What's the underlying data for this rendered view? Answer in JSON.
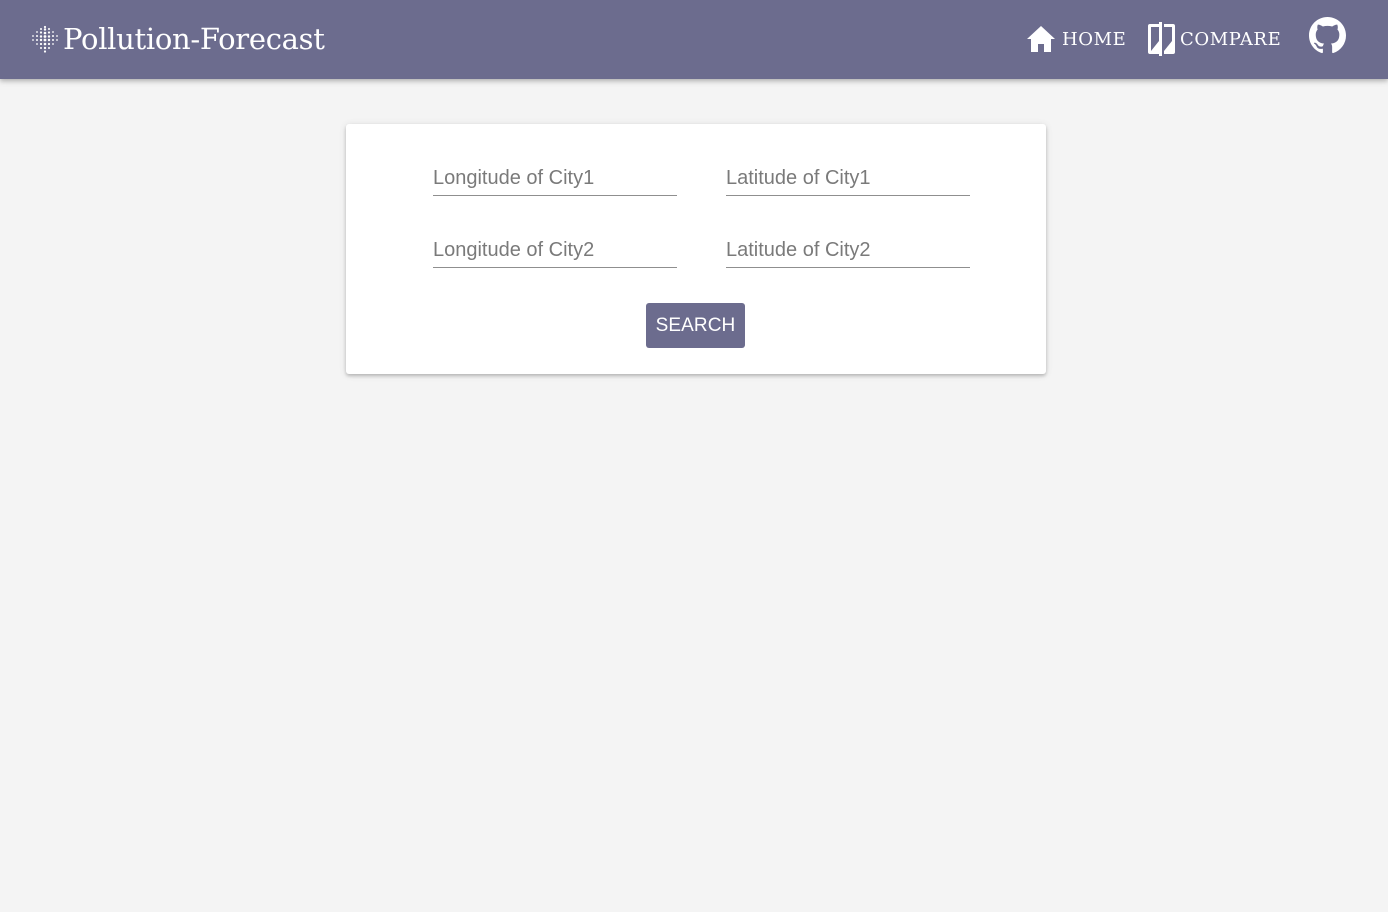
{
  "header": {
    "brand_title": "Pollution-Forecast",
    "brand_icon": "dots-grid-icon",
    "nav": [
      {
        "label": "HOME",
        "icon": "home-icon"
      },
      {
        "label": "COMPARE",
        "icon": "compare-icon"
      }
    ],
    "github_icon": "github-icon"
  },
  "form": {
    "fields": [
      {
        "placeholder": "Longitude of City1",
        "value": ""
      },
      {
        "placeholder": "Latitude of City1",
        "value": ""
      },
      {
        "placeholder": "Longitude of City2",
        "value": ""
      },
      {
        "placeholder": "Latitude of City2",
        "value": ""
      }
    ],
    "search_label": "SEARCH"
  },
  "colors": {
    "primary": "#6c6c8e",
    "background": "#f4f4f4",
    "card": "#ffffff",
    "text_on_primary": "#ffffff"
  }
}
